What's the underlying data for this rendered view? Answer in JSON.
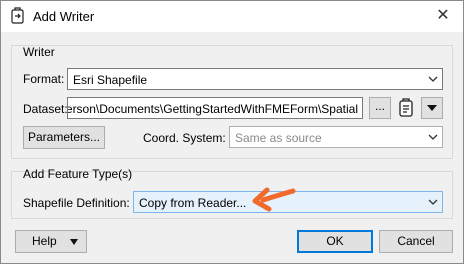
{
  "window": {
    "title": "Add Writer",
    "close_glyph": "✕"
  },
  "writer_group": {
    "title": "Writer",
    "format_label": "Format:",
    "format_value": "Esri Shapefile",
    "dataset_label": "Dataset:",
    "dataset_value": "erson\\Documents\\GettingStartedWithFMEForm\\Spatial",
    "browse_label": "...",
    "parameters_label": "Parameters...",
    "coord_label": "Coord. System:",
    "coord_value": "Same as source"
  },
  "feature_group": {
    "title": "Add Feature Type(s)",
    "shapefile_label": "Shapefile Definition:",
    "shapefile_value": "Copy from Reader..."
  },
  "footer": {
    "help_label": "Help",
    "ok_label": "OK",
    "cancel_label": "Cancel"
  },
  "colors": {
    "accent": "#0078d7",
    "arrow": "#f26a2b"
  },
  "icons": [
    "writer-icon",
    "close-icon",
    "chevron-down-icon",
    "dataset-settings-icon",
    "dropdown-arrow-icon",
    "annotation-arrow-icon"
  ]
}
